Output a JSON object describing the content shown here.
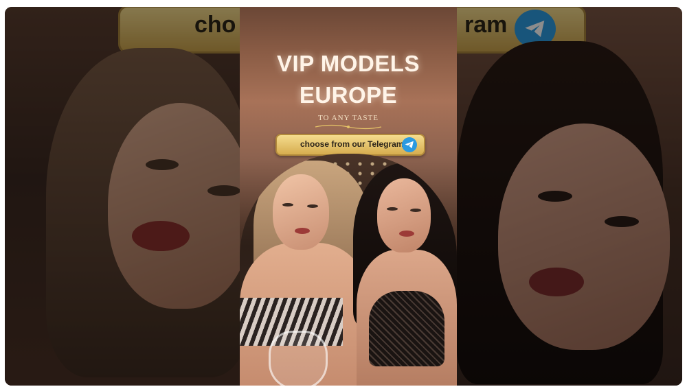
{
  "center_panel": {
    "headline_line1": "VIP MODELS",
    "headline_line2": "EUROPE",
    "tagline": "TO ANY TASTE",
    "cta_label": "choose from our Telegram",
    "cta_icon": "telegram-icon"
  },
  "side_panels": {
    "left_pill_fragment": "cho",
    "right_pill_fragment": "ram",
    "right_icon": "telegram-icon"
  },
  "colors": {
    "accent_gold": "#e6c467",
    "telegram_blue": "#2b9ae0",
    "title_text": "#fff4e8"
  }
}
